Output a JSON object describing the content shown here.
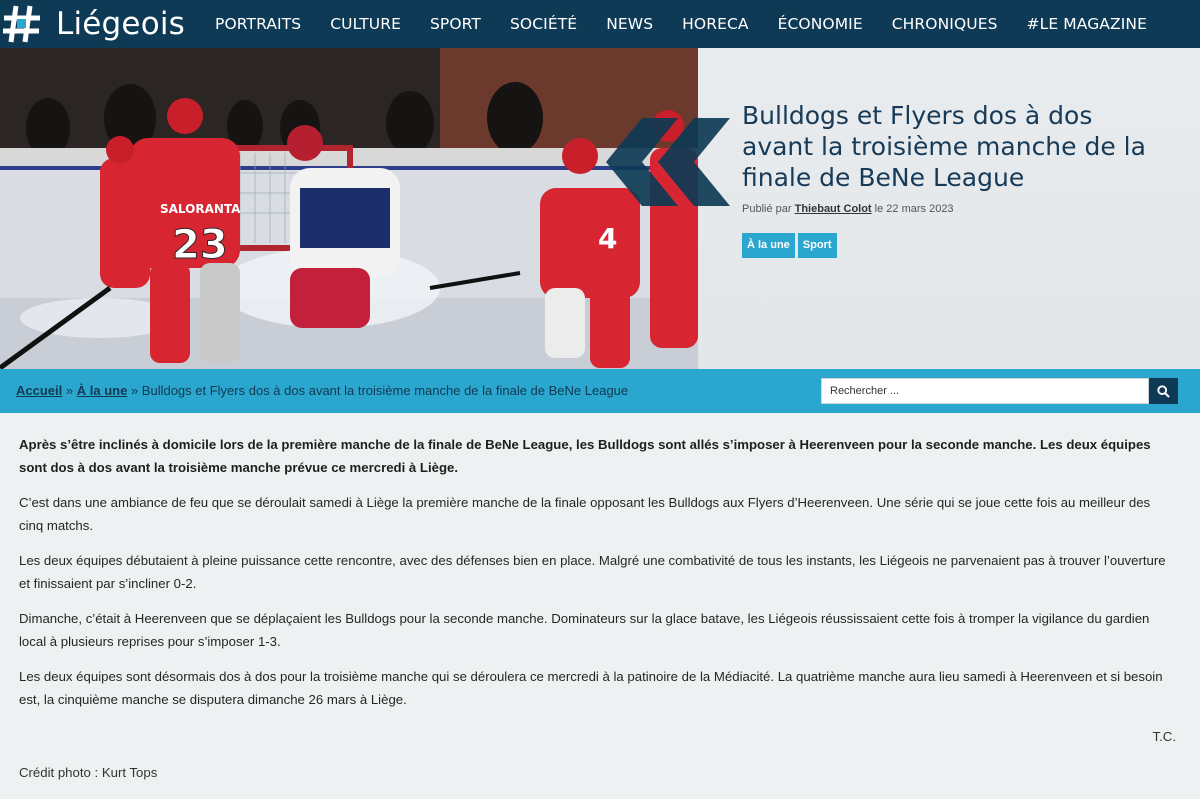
{
  "site": {
    "name": "Liégeois",
    "logo_icon": "hash-icon"
  },
  "nav": [
    {
      "label": "PORTRAITS"
    },
    {
      "label": "CULTURE"
    },
    {
      "label": "SPORT"
    },
    {
      "label": "SOCIÉTÉ"
    },
    {
      "label": "NEWS"
    },
    {
      "label": "HORECA"
    },
    {
      "label": "ÉCONOMIE"
    },
    {
      "label": "CHRONIQUES"
    },
    {
      "label": "#LE MAGAZINE"
    }
  ],
  "hero": {
    "title": "Bulldogs et Flyers dos à dos avant la troisième manche de la finale de BeNe League",
    "meta_prefix": "Publié par",
    "author": "Thiebaut Colot",
    "meta_date": "le 22 mars 2023",
    "tags": [
      {
        "label": "À la une"
      },
      {
        "label": "Sport"
      }
    ],
    "photo_jerseys": [
      "SALORANTA",
      "23",
      "4"
    ]
  },
  "breadcrumb": {
    "home": "Accueil",
    "sep": "»",
    "section": "À la une",
    "current": "Bulldogs et Flyers dos à dos avant la troisième manche de la finale de BeNe League"
  },
  "search": {
    "placeholder": "Rechercher ...",
    "icon": "search-icon"
  },
  "article": {
    "paragraphs": [
      "Après s’être inclinés à domicile lors de la première manche de la finale de BeNe League, les Bulldogs sont allés s’imposer à Heerenveen pour la seconde manche. Les deux équipes sont dos à dos avant la troisième manche prévue ce mercredi à Liège.",
      "C’est dans une ambiance de feu que se déroulait samedi à Liège la première manche de la finale opposant les Bulldogs aux Flyers d’Heerenveen. Une série qui se joue cette fois au meilleur des cinq matchs.",
      "Les deux équipes débutaient à pleine puissance cette rencontre, avec des défenses bien en place. Malgré une combativité de tous les instants, les Liégeois ne parvenaient pas à trouver l’ouverture et finissaient par s’incliner 0-2.",
      "Dimanche, c’était à Heerenveen que se déplaçaient les Bulldogs pour la seconde manche. Dominateurs sur la glace batave, les Liégeois réussissaient cette fois à tromper la vigilance du gardien local à plusieurs reprises pour s’imposer 1-3.",
      "Les deux équipes sont désormais dos à dos pour la troisième manche qui se déroulera ce mercredi à la patinoire de la Médiacité. La quatrième manche aura lieu samedi à Heerenveen et si besoin est, la cinquième manche se disputera dimanche 26 mars à Liège."
    ],
    "signature": "T.C.",
    "credit": "Crédit photo : Kurt Tops"
  },
  "colors": {
    "navy": "#0e3a55",
    "accent": "#2aa6cf",
    "title": "#163a57"
  }
}
